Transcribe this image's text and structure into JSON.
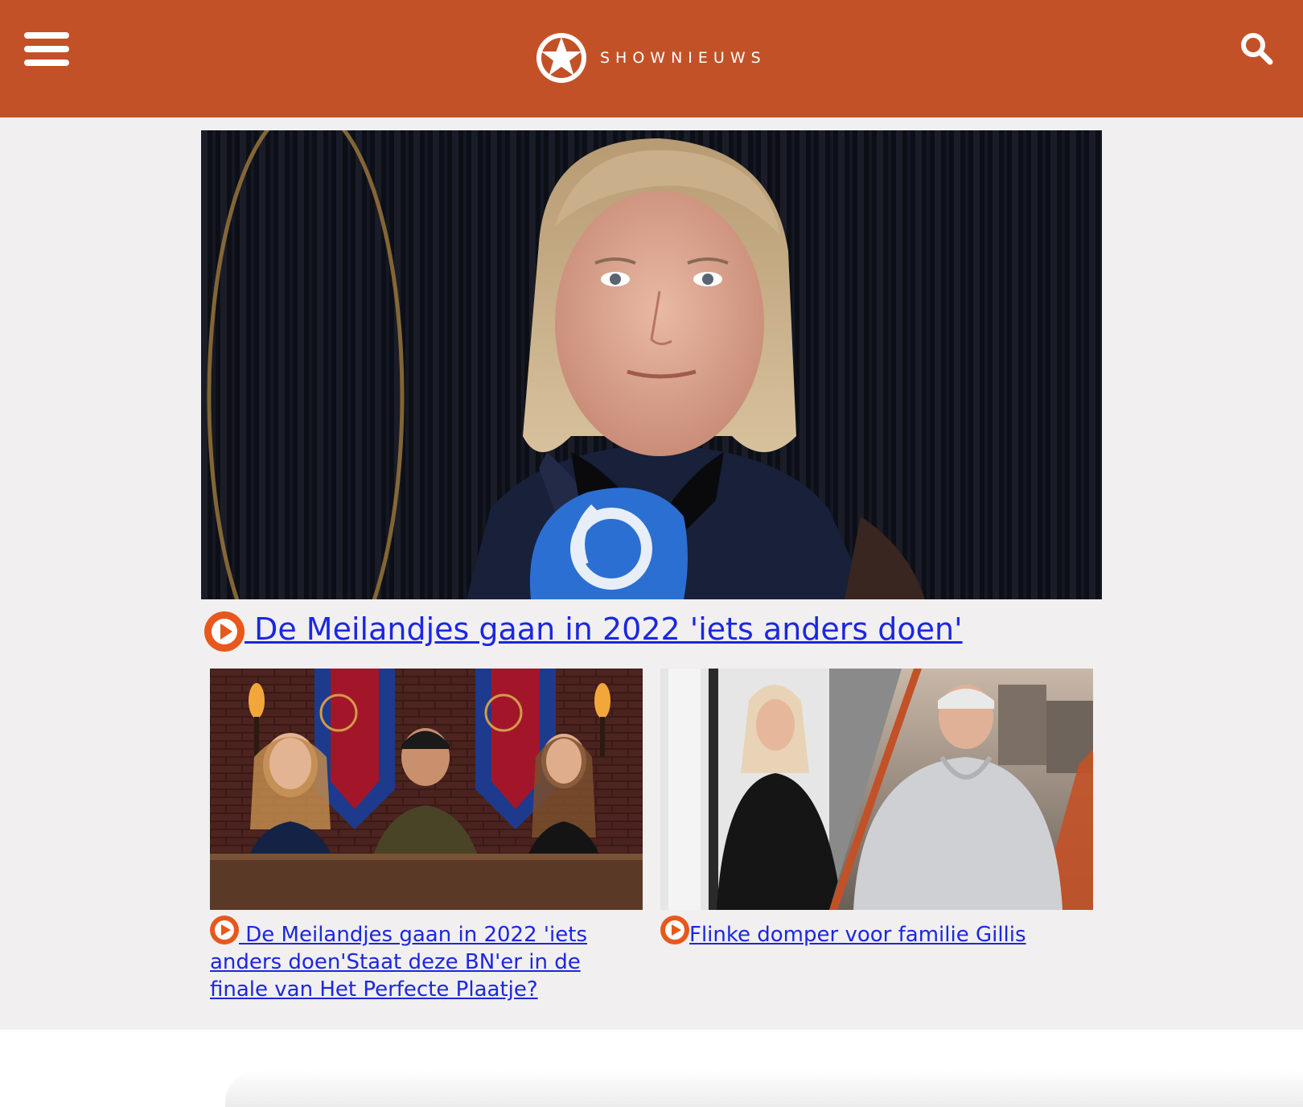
{
  "header": {
    "brand": "SHOWNIEUWS",
    "menu_icon": "hamburger-menu-icon",
    "search_icon": "search-icon",
    "background_color": "#c35127"
  },
  "hero": {
    "title": " De Meilandjes gaan in 2022 'iets anders doen'",
    "image": "woman-interview-photo",
    "microphone_logo": "6",
    "play_icon": "play-icon"
  },
  "cards": [
    {
      "title": " De Meilandjes gaan in 2022 'iets anders doen'Staat deze BN'er in de finale van Het Perfecte Plaatje?",
      "image": "three-hosts-at-table-photo",
      "play_icon": "play-icon"
    },
    {
      "title": "Flinke domper voor familie Gillis",
      "image": "two-people-split-photo",
      "play_icon": "play-icon"
    }
  ],
  "colors": {
    "accent": "#c35127",
    "link": "#1b27e0",
    "play": "#e8571c",
    "content_bg": "#f1eff0"
  }
}
